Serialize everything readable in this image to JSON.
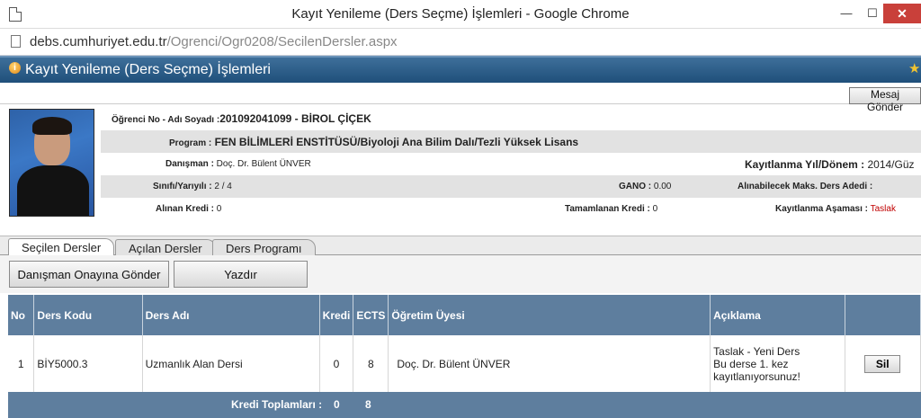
{
  "window": {
    "title": "Kayıt Yenileme (Ders Seçme) İşlemleri - Google Chrome",
    "minimize": "—",
    "maximize": "☐",
    "close": "✕"
  },
  "address": {
    "host": "debs.cumhuriyet.edu.tr",
    "path": "/Ogrenci/Ogr0208/SecilenDersler.aspx"
  },
  "page": {
    "title": "Kayıt Yenileme (Ders Seçme) İşlemleri",
    "message_button": "Mesaj Gönder"
  },
  "student": {
    "no_label": "Öğrenci No - Adı Soyadı :",
    "no_value": "201092041099 - BİROL ÇİÇEK",
    "program_label": "Program :",
    "program_value": " FEN BİLİMLERİ ENSTİTÜSÜ/Biyoloji Ana Bilim Dalı/Tezli Yüksek Lisans",
    "advisor_label": "Danışman :",
    "advisor_value": " Doç. Dr. Bülent ÜNVER",
    "term_label": "Kayıtlanma Yıl/Dönem :",
    "term_value": " 2014/Güz",
    "class_label": "Sınıfı/Yarıyılı :",
    "class_value": " 2 / 4",
    "gano_label": "GANO :",
    "gano_value": " 0.00",
    "max_label": "Alınabilecek Maks. Ders Adedi :",
    "max_value": "",
    "credit_label": "Alınan Kredi :",
    "credit_value": " 0",
    "completed_label": "Tamamlanan Kredi :",
    "completed_value": " 0",
    "stage_label": "Kayıtlanma Aşaması :",
    "stage_value": " Taslak"
  },
  "tabs": [
    "Seçilen Dersler",
    "Açılan Dersler",
    "Ders Programı"
  ],
  "actions": {
    "send_button": "Danışman Onayına Gönder",
    "print_button": "Yazdır"
  },
  "table": {
    "headers": [
      "No",
      "Ders Kodu",
      "Ders Adı",
      "Kredi",
      "ECTS",
      "Öğretim Üyesi",
      "Açıklama",
      ""
    ],
    "rows": [
      {
        "no": "1",
        "code": "BİY5000.3",
        "name": "Uzmanlık Alan Dersi",
        "credit": "0",
        "ects": "8",
        "instructor": "Doç. Dr. Bülent ÜNVER",
        "note_line1": "Taslak - Yeni Ders",
        "note_line2": "Bu derse 1. kez",
        "note_line3": "kayıtlanıyorsunuz!",
        "delete_button": "Sil"
      }
    ],
    "totals_label": "Kredi Toplamları :",
    "totals_credit": "0",
    "totals_ects": "8"
  },
  "colors": {
    "header_bar": "#1f4f7a",
    "table_header": "#5e7e9e",
    "stage_value": "#c00000"
  }
}
